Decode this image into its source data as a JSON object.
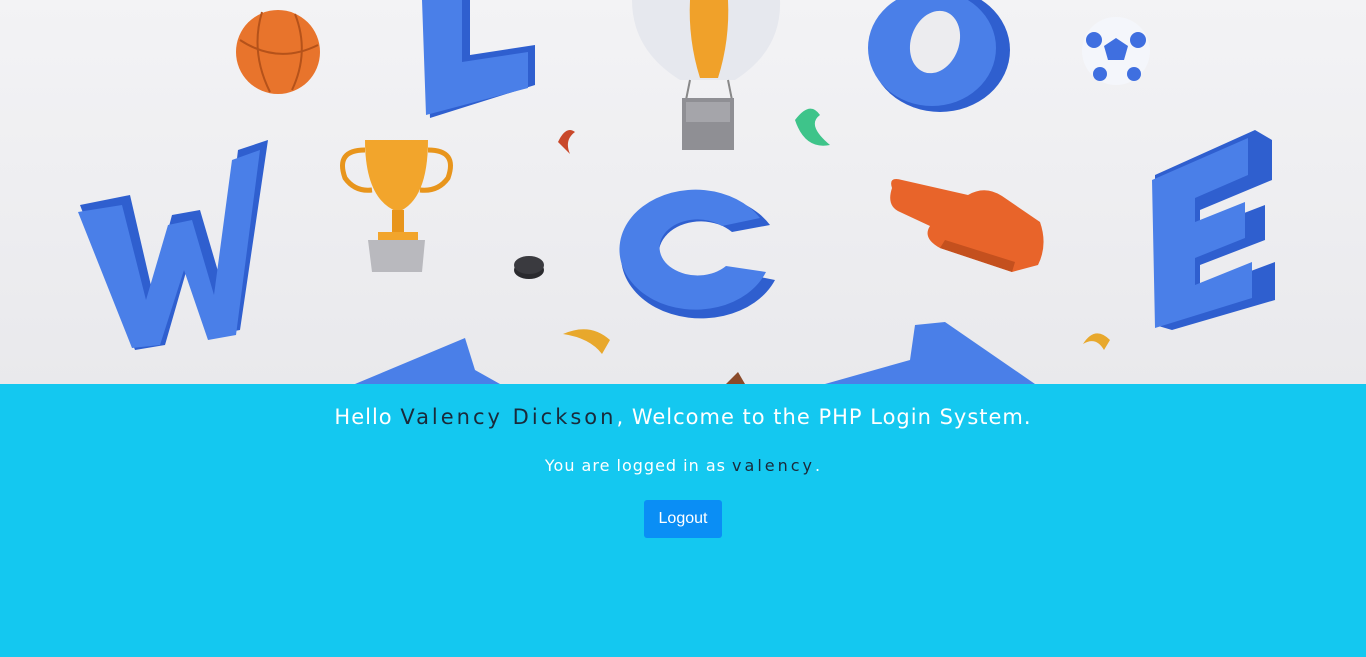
{
  "hero": {
    "letters": [
      "W",
      "L",
      "O",
      "C",
      "E"
    ],
    "icons": [
      "basketball-icon",
      "trophy-icon",
      "hot-air-balloon-icon",
      "soccer-ball-icon",
      "foam-finger-icon",
      "hockey-puck-icon",
      "confetti-icon"
    ]
  },
  "greeting": {
    "prefix": "Hello ",
    "name": "Valency Dickson",
    "suffix": ", Welcome to the PHP Login System."
  },
  "status": {
    "prefix": "You are logged in as ",
    "username": "valency",
    "suffix": "."
  },
  "actions": {
    "logout_label": "Logout"
  },
  "colors": {
    "background": "#14c8f0",
    "button": "#0a8ef5",
    "letters": "#3f73e0",
    "name_text": "#1a2a3a"
  }
}
